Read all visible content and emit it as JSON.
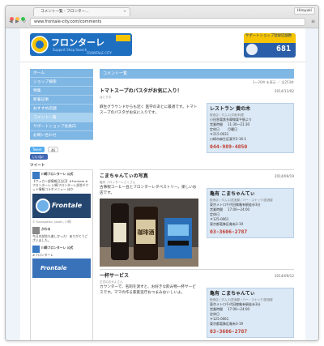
{
  "browser": {
    "tab_title": "コメント一覧 - フロンター…",
    "tab_close": "×",
    "user_label": "Hiroyuki",
    "url": "www.frontale-city.com/comments",
    "back": "◀",
    "forward": "▶",
    "reload": "↻",
    "menu": "≡"
  },
  "header": {
    "logo_main": "フロンターレ",
    "logo_sub": "Support Shop Search",
    "logo_sub2": "FRONTALE CITY",
    "banner_top": "サポートショップ登録店舗数",
    "banner_count": "681"
  },
  "sidebar": {
    "items": [
      {
        "label": "ホーム"
      },
      {
        "label": "ショップ検索"
      },
      {
        "label": "特集"
      },
      {
        "label": "新着記事"
      },
      {
        "label": "おすすめ店舗"
      },
      {
        "label": "コメント一覧"
      },
      {
        "label": "サポートショップ会員向"
      },
      {
        "label": "お問い合わせ"
      }
    ],
    "tweet_button": "Tweet",
    "tweet_count": "46",
    "like_button": "いいね！",
    "twitter_label": "ツイート",
    "tweets": [
      {
        "user": "川崎フロンターレ 公式",
        "text": "【サッカー部情報日当日】#Frontale #フロンターレ 川崎フロンターレ試合チケット情報コラボメニュー ほか"
      },
      {
        "user": "かわる",
        "text": "今日の試合も楽しかった！ありがとうございました。"
      },
      {
        "user": "川崎フロンターレ 公式",
        "text": "#フロンターレ"
      }
    ],
    "tweet_img1": "Frontale",
    "tweet_img2": "Frontale",
    "tweet_caption": "© Kanagawa, Japan, 川崎"
  },
  "main": {
    "list_header": "コメント一覧",
    "pager": "1〜20件 を表示 ／ 全253件",
    "entries": [
      {
        "title": "トマトスープのパスタがお気に入り！",
        "date": "2014/11/02",
        "author": "ぱとりお",
        "body": "麻生グラウンドからも近く 医学のあとに最適です。トマトスープのパスタがお気に入りです。",
        "shop": {
          "name": "レストラン 黄の木",
          "category": "飲食店 / ダムス/洋食/料理",
          "address": "小田急電鉄多摩線栗平駅より",
          "hours_label": "営業時間",
          "hours": "11:30〜21:30",
          "holiday_label": "定休日",
          "holiday": "月曜日",
          "zip": "〒215-0031",
          "city": "川崎市麻生区栗平2-16-1",
          "phone": "044-989-4850"
        }
      },
      {
        "title": "こまちゃんてぃの写真",
        "date": "2014/09/19",
        "author": "亀有 フロンターレさくさん",
        "body": "古事製コーヒー豆とフロンターレタペストリー。楽しいお店です。",
        "photo_caption": "珈琲酒",
        "shop": {
          "name": "亀有 こまちゃんてぃ",
          "category": "飲食店 / ダムス/居酒屋 / バー・スナック/居酒屋",
          "address": "東京メトロ千代田線亀有駅徒歩3分",
          "hours_label": "営業時間",
          "hours": "17:00〜24:00",
          "holiday_label": "定休日",
          "holiday": "",
          "zip": "〒125-0061",
          "city": "東京都葛飾区亀有3-19",
          "phone": "03-3606-2787"
        }
      },
      {
        "title": "一杯サービス",
        "date": "2014/09/12",
        "author": "正式のおかよさん",
        "body": "カウンターで、名刺を渡すと、お好きな飲み物一杯サービスです。ママの作る家家造庁おつまみおいしいよ。",
        "shop": {
          "name": "亀有 こまちゃんてぃ",
          "category": "飲食店 / ダムス/居酒屋 / バー・スナック/居酒屋",
          "address": "東京メトロ千代田線亀有駅徒歩3分",
          "hours_label": "営業時間",
          "hours": "17:00〜24:00",
          "holiday_label": "定休日",
          "holiday": "",
          "zip": "〒125-0061",
          "city": "東京都葛飾区亀有3-19",
          "phone": "03-3606-2787"
        }
      }
    ]
  },
  "colors": {
    "accent": "#7eb6e4",
    "active": "#a8d2f0",
    "phone": "#c0392b",
    "shop_bg": "#dbe8f5"
  }
}
